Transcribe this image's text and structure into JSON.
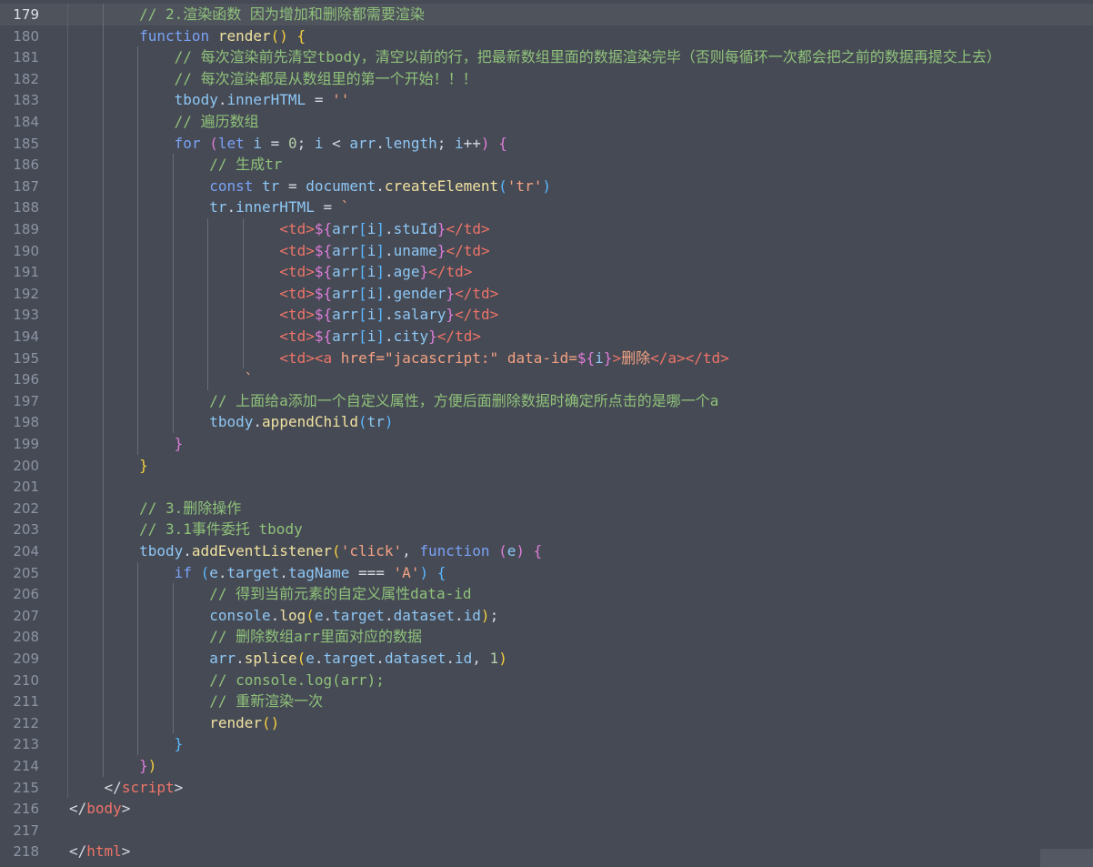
{
  "editor": {
    "language": "html",
    "colors": {
      "background": "#464a54",
      "line_number": "#8c95a5",
      "comment": "#8fc27a",
      "keyword": "#7aa2f7",
      "function": "#f0e2a0",
      "variable": "#8ec7f5",
      "string": "#f3a183",
      "tag": "#ee7469"
    },
    "lines": [
      {
        "n": "179",
        "indent": 2,
        "active": true,
        "tokens": [
          [
            "cmt",
            "// 2.渲染函数 因为增加和删除都需要渲染"
          ]
        ]
      },
      {
        "n": "180",
        "indent": 2,
        "tokens": [
          [
            "kw",
            "function"
          ],
          [
            "pn",
            " "
          ],
          [
            "fn",
            "render"
          ],
          [
            "br1",
            "()"
          ],
          [
            "pn",
            " "
          ],
          [
            "br1",
            "{"
          ]
        ]
      },
      {
        "n": "181",
        "indent": 3,
        "tokens": [
          [
            "cmt",
            "// 每次渲染前先清空tbody，清空以前的行，把最新数组里面的数据渲染完毕（否则每循环一次都会把之前的数据再提交上去）"
          ]
        ]
      },
      {
        "n": "182",
        "indent": 3,
        "tokens": [
          [
            "cmt",
            "// 每次渲染都是从数组里的第一个开始！！！"
          ]
        ]
      },
      {
        "n": "183",
        "indent": 3,
        "tokens": [
          [
            "vr",
            "tbody"
          ],
          [
            "pn",
            "."
          ],
          [
            "vr",
            "innerHTML"
          ],
          [
            "pn",
            " = "
          ],
          [
            "st",
            "''"
          ]
        ]
      },
      {
        "n": "184",
        "indent": 3,
        "tokens": [
          [
            "cmt",
            "// 遍历数组"
          ]
        ]
      },
      {
        "n": "185",
        "indent": 3,
        "tokens": [
          [
            "kw",
            "for"
          ],
          [
            "pn",
            " "
          ],
          [
            "br2",
            "("
          ],
          [
            "kw",
            "let"
          ],
          [
            "pn",
            " "
          ],
          [
            "vr",
            "i"
          ],
          [
            "pn",
            " = "
          ],
          [
            "nm",
            "0"
          ],
          [
            "pn",
            "; "
          ],
          [
            "vr",
            "i"
          ],
          [
            "pn",
            " < "
          ],
          [
            "vr",
            "arr"
          ],
          [
            "pn",
            "."
          ],
          [
            "vr",
            "length"
          ],
          [
            "pn",
            "; "
          ],
          [
            "vr",
            "i"
          ],
          [
            "pn",
            "++"
          ],
          [
            "br2",
            ")"
          ],
          [
            "pn",
            " "
          ],
          [
            "br2",
            "{"
          ]
        ]
      },
      {
        "n": "186",
        "indent": 4,
        "tokens": [
          [
            "cmt",
            "// 生成tr"
          ]
        ]
      },
      {
        "n": "187",
        "indent": 4,
        "tokens": [
          [
            "kw",
            "const"
          ],
          [
            "pn",
            " "
          ],
          [
            "vr",
            "tr"
          ],
          [
            "pn",
            " = "
          ],
          [
            "vr",
            "document"
          ],
          [
            "pn",
            "."
          ],
          [
            "fn",
            "createElement"
          ],
          [
            "br3",
            "("
          ],
          [
            "st",
            "'tr'"
          ],
          [
            "br3",
            ")"
          ]
        ]
      },
      {
        "n": "188",
        "indent": 4,
        "tokens": [
          [
            "vr",
            "tr"
          ],
          [
            "pn",
            "."
          ],
          [
            "vr",
            "innerHTML"
          ],
          [
            "pn",
            " = "
          ],
          [
            "st",
            "`"
          ]
        ]
      },
      {
        "n": "189",
        "indent": 6,
        "tokens": [
          [
            "tg",
            "<td>"
          ],
          [
            "br2",
            "${"
          ],
          [
            "vr",
            "arr"
          ],
          [
            "br3",
            "["
          ],
          [
            "vr",
            "i"
          ],
          [
            "br3",
            "]"
          ],
          [
            "pn",
            "."
          ],
          [
            "vr",
            "stuId"
          ],
          [
            "br2",
            "}"
          ],
          [
            "tg",
            "</td>"
          ]
        ]
      },
      {
        "n": "190",
        "indent": 6,
        "tokens": [
          [
            "tg",
            "<td>"
          ],
          [
            "br2",
            "${"
          ],
          [
            "vr",
            "arr"
          ],
          [
            "br3",
            "["
          ],
          [
            "vr",
            "i"
          ],
          [
            "br3",
            "]"
          ],
          [
            "pn",
            "."
          ],
          [
            "vr",
            "uname"
          ],
          [
            "br2",
            "}"
          ],
          [
            "tg",
            "</td>"
          ]
        ]
      },
      {
        "n": "191",
        "indent": 6,
        "tokens": [
          [
            "tg",
            "<td>"
          ],
          [
            "br2",
            "${"
          ],
          [
            "vr",
            "arr"
          ],
          [
            "br3",
            "["
          ],
          [
            "vr",
            "i"
          ],
          [
            "br3",
            "]"
          ],
          [
            "pn",
            "."
          ],
          [
            "vr",
            "age"
          ],
          [
            "br2",
            "}"
          ],
          [
            "tg",
            "</td>"
          ]
        ]
      },
      {
        "n": "192",
        "indent": 6,
        "tokens": [
          [
            "tg",
            "<td>"
          ],
          [
            "br2",
            "${"
          ],
          [
            "vr",
            "arr"
          ],
          [
            "br3",
            "["
          ],
          [
            "vr",
            "i"
          ],
          [
            "br3",
            "]"
          ],
          [
            "pn",
            "."
          ],
          [
            "vr",
            "gender"
          ],
          [
            "br2",
            "}"
          ],
          [
            "tg",
            "</td>"
          ]
        ]
      },
      {
        "n": "193",
        "indent": 6,
        "tokens": [
          [
            "tg",
            "<td>"
          ],
          [
            "br2",
            "${"
          ],
          [
            "vr",
            "arr"
          ],
          [
            "br3",
            "["
          ],
          [
            "vr",
            "i"
          ],
          [
            "br3",
            "]"
          ],
          [
            "pn",
            "."
          ],
          [
            "vr",
            "salary"
          ],
          [
            "br2",
            "}"
          ],
          [
            "tg",
            "</td>"
          ]
        ]
      },
      {
        "n": "194",
        "indent": 6,
        "tokens": [
          [
            "tg",
            "<td>"
          ],
          [
            "br2",
            "${"
          ],
          [
            "vr",
            "arr"
          ],
          [
            "br3",
            "["
          ],
          [
            "vr",
            "i"
          ],
          [
            "br3",
            "]"
          ],
          [
            "pn",
            "."
          ],
          [
            "vr",
            "city"
          ],
          [
            "br2",
            "}"
          ],
          [
            "tg",
            "</td>"
          ]
        ]
      },
      {
        "n": "195",
        "indent": 6,
        "tokens": [
          [
            "tg",
            "<td><a "
          ],
          [
            "st",
            "href=\"jacascript:\" data-id="
          ],
          [
            "br2",
            "${"
          ],
          [
            "vr",
            "i"
          ],
          [
            "br2",
            "}"
          ],
          [
            "tg",
            ">"
          ],
          [
            "st",
            "删除"
          ],
          [
            "tg",
            "</a></td>"
          ]
        ]
      },
      {
        "n": "196",
        "indent": 5,
        "tokens": [
          [
            "st",
            "`"
          ]
        ]
      },
      {
        "n": "197",
        "indent": 4,
        "tokens": [
          [
            "cmt",
            "// 上面给a添加一个自定义属性，方便后面删除数据时确定所点击的是哪一个a"
          ]
        ]
      },
      {
        "n": "198",
        "indent": 4,
        "tokens": [
          [
            "vr",
            "tbody"
          ],
          [
            "pn",
            "."
          ],
          [
            "fn",
            "appendChild"
          ],
          [
            "br3",
            "("
          ],
          [
            "vr",
            "tr"
          ],
          [
            "br3",
            ")"
          ]
        ]
      },
      {
        "n": "199",
        "indent": 3,
        "tokens": [
          [
            "br2",
            "}"
          ]
        ]
      },
      {
        "n": "200",
        "indent": 2,
        "tokens": [
          [
            "br1",
            "}"
          ]
        ]
      },
      {
        "n": "201",
        "indent": 0,
        "tokens": []
      },
      {
        "n": "202",
        "indent": 2,
        "tokens": [
          [
            "cmt",
            "// 3.删除操作"
          ]
        ]
      },
      {
        "n": "203",
        "indent": 2,
        "tokens": [
          [
            "cmt",
            "// 3.1事件委托 tbody"
          ]
        ]
      },
      {
        "n": "204",
        "indent": 2,
        "tokens": [
          [
            "vr",
            "tbody"
          ],
          [
            "pn",
            "."
          ],
          [
            "fn",
            "addEventListener"
          ],
          [
            "br1",
            "("
          ],
          [
            "st",
            "'click'"
          ],
          [
            "pn",
            ", "
          ],
          [
            "kw",
            "function"
          ],
          [
            "pn",
            " "
          ],
          [
            "br2",
            "("
          ],
          [
            "vr",
            "e"
          ],
          [
            "br2",
            ")"
          ],
          [
            "pn",
            " "
          ],
          [
            "br2",
            "{"
          ]
        ]
      },
      {
        "n": "205",
        "indent": 3,
        "tokens": [
          [
            "kw",
            "if"
          ],
          [
            "pn",
            " "
          ],
          [
            "br3",
            "("
          ],
          [
            "vr",
            "e"
          ],
          [
            "pn",
            "."
          ],
          [
            "vr",
            "target"
          ],
          [
            "pn",
            "."
          ],
          [
            "vr",
            "tagName"
          ],
          [
            "pn",
            " === "
          ],
          [
            "st",
            "'A'"
          ],
          [
            "br3",
            ")"
          ],
          [
            "pn",
            " "
          ],
          [
            "br3",
            "{"
          ]
        ]
      },
      {
        "n": "206",
        "indent": 4,
        "tokens": [
          [
            "cmt",
            "// 得到当前元素的自定义属性data-id"
          ]
        ]
      },
      {
        "n": "207",
        "indent": 4,
        "tokens": [
          [
            "vr",
            "console"
          ],
          [
            "pn",
            "."
          ],
          [
            "fn",
            "log"
          ],
          [
            "br1",
            "("
          ],
          [
            "vr",
            "e"
          ],
          [
            "pn",
            "."
          ],
          [
            "vr",
            "target"
          ],
          [
            "pn",
            "."
          ],
          [
            "vr",
            "dataset"
          ],
          [
            "pn",
            "."
          ],
          [
            "vr",
            "id"
          ],
          [
            "br1",
            ")"
          ],
          [
            "pn",
            ";"
          ]
        ]
      },
      {
        "n": "208",
        "indent": 4,
        "tokens": [
          [
            "cmt",
            "// 删除数组arr里面对应的数据"
          ]
        ]
      },
      {
        "n": "209",
        "indent": 4,
        "tokens": [
          [
            "vr",
            "arr"
          ],
          [
            "pn",
            "."
          ],
          [
            "fn",
            "splice"
          ],
          [
            "br1",
            "("
          ],
          [
            "vr",
            "e"
          ],
          [
            "pn",
            "."
          ],
          [
            "vr",
            "target"
          ],
          [
            "pn",
            "."
          ],
          [
            "vr",
            "dataset"
          ],
          [
            "pn",
            "."
          ],
          [
            "vr",
            "id"
          ],
          [
            "pn",
            ", "
          ],
          [
            "nm",
            "1"
          ],
          [
            "br1",
            ")"
          ]
        ]
      },
      {
        "n": "210",
        "indent": 4,
        "tokens": [
          [
            "cmt",
            "// console.log(arr);"
          ]
        ]
      },
      {
        "n": "211",
        "indent": 4,
        "tokens": [
          [
            "cmt",
            "// 重新渲染一次"
          ]
        ]
      },
      {
        "n": "212",
        "indent": 4,
        "tokens": [
          [
            "fn",
            "render"
          ],
          [
            "br1",
            "()"
          ]
        ]
      },
      {
        "n": "213",
        "indent": 3,
        "tokens": [
          [
            "br3",
            "}"
          ]
        ]
      },
      {
        "n": "214",
        "indent": 2,
        "tokens": [
          [
            "br2",
            "}"
          ],
          [
            "br1",
            ")"
          ]
        ]
      },
      {
        "n": "215",
        "indent": 1,
        "tokens": [
          [
            "pn",
            "</"
          ],
          [
            "tg",
            "script"
          ],
          [
            "pn",
            ">"
          ]
        ]
      },
      {
        "n": "216",
        "indent": 0,
        "tokens": [
          [
            "pn",
            "</"
          ],
          [
            "tg",
            "body"
          ],
          [
            "pn",
            ">"
          ]
        ]
      },
      {
        "n": "217",
        "indent": 0,
        "tokens": []
      },
      {
        "n": "218",
        "indent": 0,
        "tokens": [
          [
            "pn",
            "</"
          ],
          [
            "tg",
            "html"
          ],
          [
            "pn",
            ">"
          ]
        ]
      }
    ]
  }
}
